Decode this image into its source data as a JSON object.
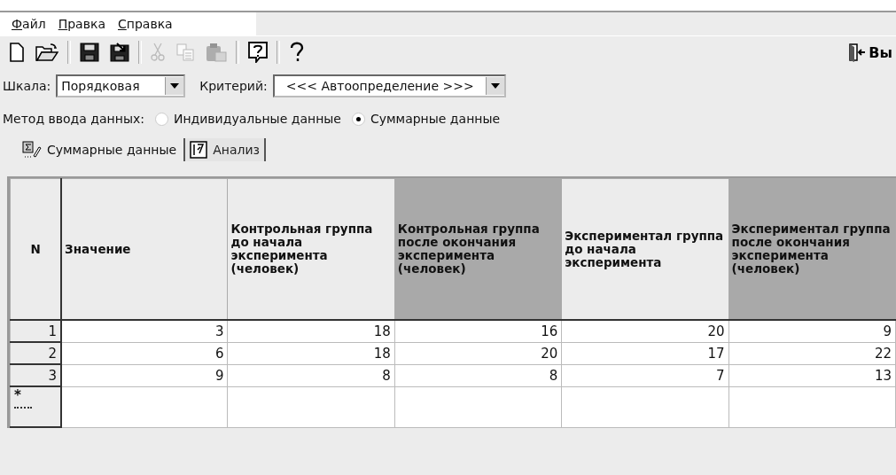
{
  "menu": [
    {
      "label": "Файл"
    },
    {
      "label": "Правка"
    },
    {
      "label": "Справка"
    }
  ],
  "toolbar": {
    "buttons": [
      {
        "kind": "new",
        "disabled": false
      },
      {
        "kind": "open",
        "disabled": false
      },
      {
        "kind": "sep"
      },
      {
        "kind": "save",
        "disabled": false
      },
      {
        "kind": "saveas",
        "disabled": false
      },
      {
        "kind": "sep"
      },
      {
        "kind": "cut",
        "disabled": true
      },
      {
        "kind": "copy",
        "disabled": true
      },
      {
        "kind": "paste",
        "disabled": true
      },
      {
        "kind": "sep"
      },
      {
        "kind": "help",
        "disabled": false
      },
      {
        "kind": "sep"
      },
      {
        "kind": "whatsthis",
        "disabled": false
      }
    ],
    "exit_label": "Вы"
  },
  "scale": {
    "label": "Шкала:",
    "value": "Порядковая"
  },
  "criterion": {
    "label": "Критерий:",
    "value": "<<< Автоопределение >>>"
  },
  "input_method": {
    "label": "Метод ввода данных:",
    "options": [
      {
        "label": "Индивидуальные данные",
        "selected": false
      },
      {
        "label": "Суммарные данные",
        "selected": true
      }
    ]
  },
  "tabs": [
    {
      "label": "Суммарные данные",
      "kind": "sum",
      "selected": true
    },
    {
      "label": "Анализ",
      "kind": "analysis",
      "selected": false
    }
  ],
  "table": {
    "columns": [
      {
        "label": "N",
        "highlighted": false
      },
      {
        "label": "Значение",
        "highlighted": false
      },
      {
        "label": "Контрольная группа до начала эксперимента (человек)",
        "highlighted": false
      },
      {
        "label": "Контрольная группа после окончания эксперимента (человек)",
        "highlighted": true
      },
      {
        "label": "Экспериментал группа до начала эксперимента",
        "highlighted": false
      },
      {
        "label": "Экспериментал группа после окончания эксперимента (человек)",
        "highlighted": true
      }
    ],
    "rows": [
      [
        "1",
        "3",
        "18",
        "16",
        "20",
        "9"
      ],
      [
        "2",
        "6",
        "18",
        "20",
        "17",
        "22"
      ],
      [
        "3",
        "9",
        "8",
        "8",
        "7",
        "13"
      ]
    ],
    "new_row_marker": "*"
  }
}
